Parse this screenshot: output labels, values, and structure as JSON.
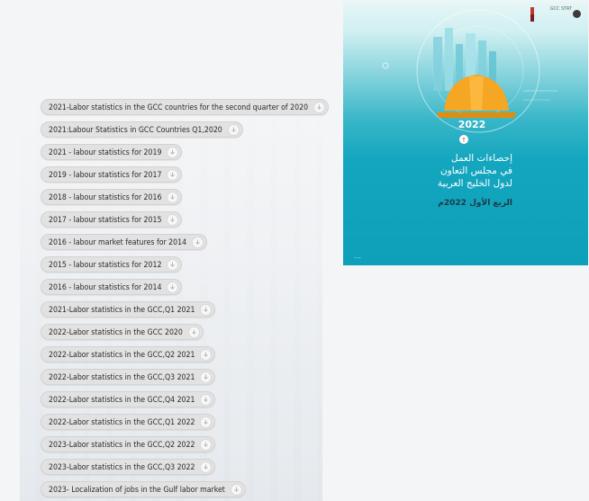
{
  "links": [
    "2021-Labor statistics in the GCC countries for the second quarter of 2020",
    "2021:Labour Statistics in GCC Countries Q1,2020",
    "2021 - labour statistics for 2019",
    "2019 - labour statistics for 2017",
    "2018 - labour statistics for 2016",
    "2017 - labour statistics for 2015",
    "2016 - labour market features for 2014",
    "2015 - labour statistics for 2012",
    "2016 - labour statistics for 2014",
    "2021-Labor statistics in the GCC,Q1 2021",
    "2022-Labor statistics in the GCC 2020",
    "2022-Labor statistics in the GCC,Q2 2021",
    "2022-Labor statistics in the GCC,Q3 2021",
    "2022-Labor statistics in the GCC,Q4 2021",
    "2022-Labor statistics in the GCC,Q1 2022",
    "2023-Labor statistics in the GCC,Q2 2022",
    "2023-Labor statistics in the GCC,Q3 2022",
    "2023- Localization of jobs in the Gulf labor market"
  ],
  "icons": {
    "link": "download-icon"
  },
  "cover": {
    "year": "2022",
    "title_line1": "إحصاءات العمل",
    "title_line2": "في مجلس التعاون",
    "title_line3": "لدول الخليج العربية",
    "subtitle": "الربع الأول 2022م",
    "logo_text": "GCC STAT"
  },
  "colors": {
    "cover_teal": "#14a6bf",
    "button_bg": "#e2e2e2",
    "hardhat": "#f5a623"
  }
}
